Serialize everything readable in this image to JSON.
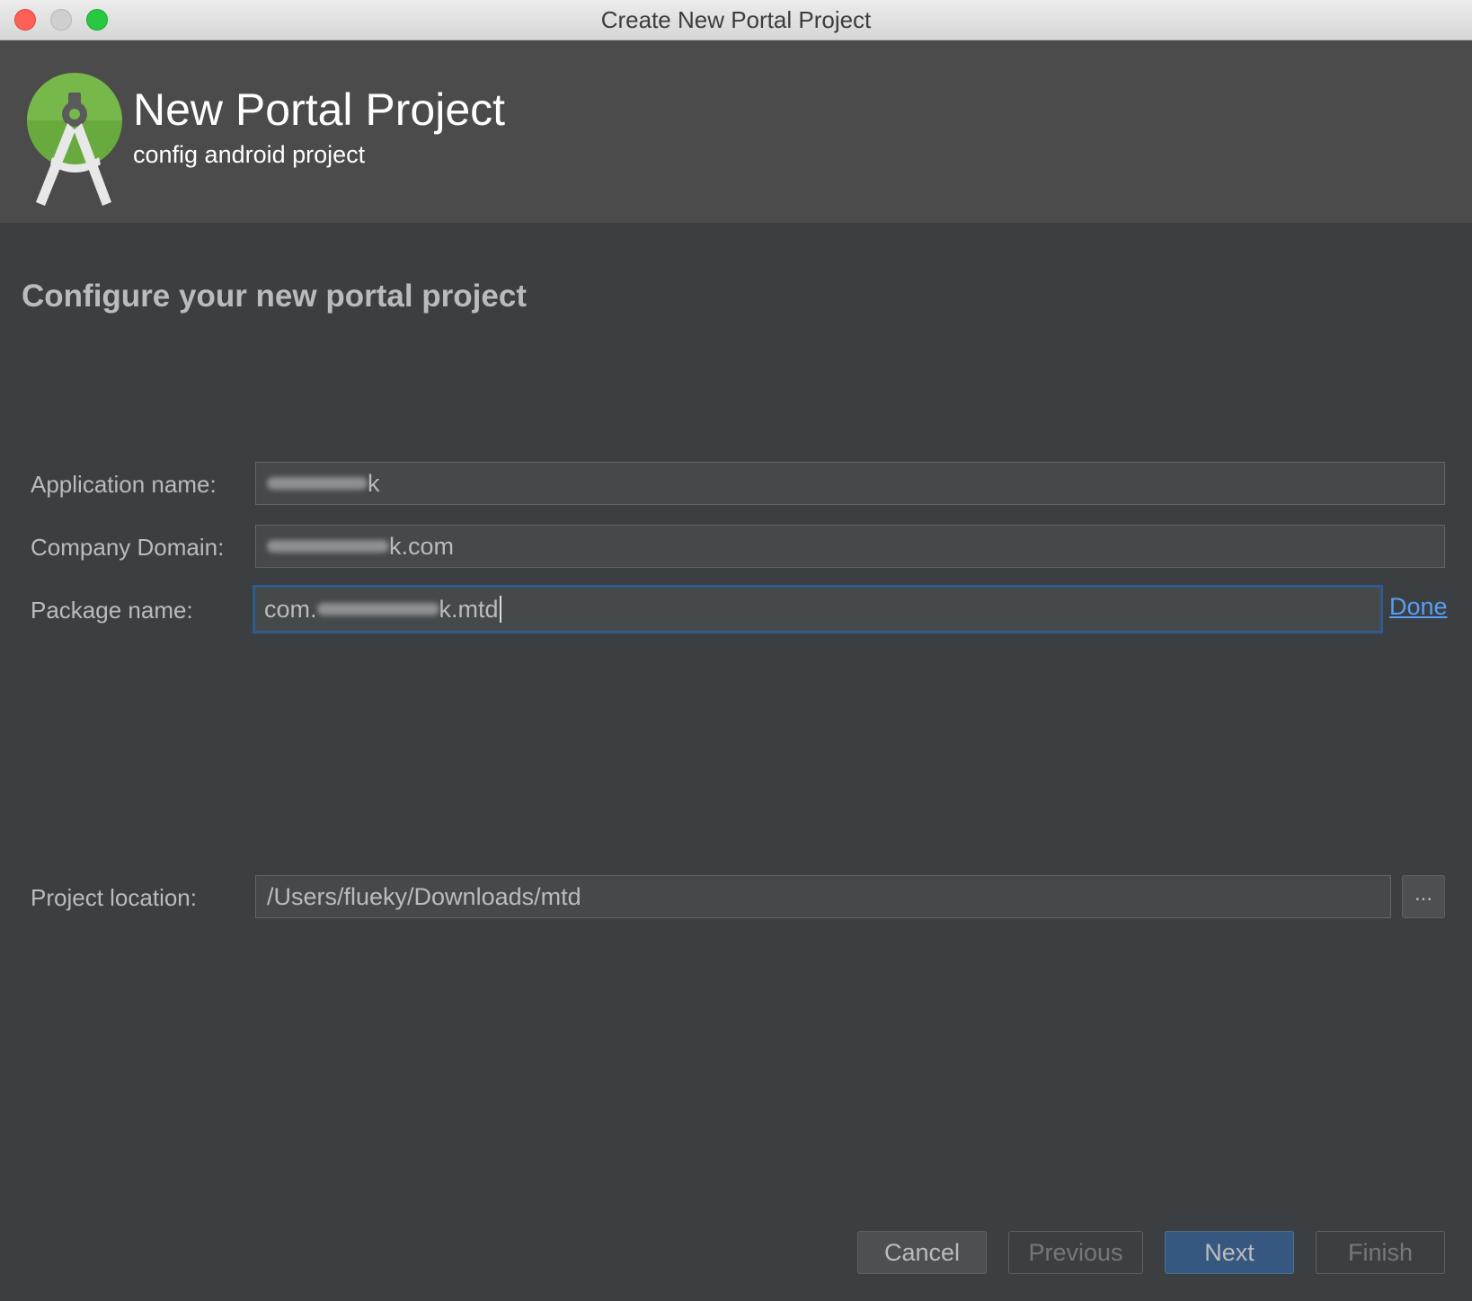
{
  "window": {
    "title": "Create New Portal Project"
  },
  "header": {
    "title": "New Portal Project",
    "subtitle": "config android project",
    "logo_icon": "android-studio-logo-icon"
  },
  "main": {
    "heading": "Configure your new portal project"
  },
  "form": {
    "application_name": {
      "label": "Application name:",
      "value_suffix": "k"
    },
    "company_domain": {
      "label": "Company Domain:",
      "value_suffix": "k.com"
    },
    "package_name": {
      "label": "Package name:",
      "value_prefix": "com.",
      "value_suffix": "k.mtd",
      "done_label": "Done"
    },
    "project_location": {
      "label": "Project location:",
      "value": "/Users/flueky/Downloads/mtd",
      "browse_label": "..."
    }
  },
  "footer": {
    "cancel_label": "Cancel",
    "previous_label": "Previous",
    "next_label": "Next",
    "finish_label": "Finish"
  },
  "colors": {
    "background": "#3c3f41",
    "header_background": "#4b4b4b",
    "field_background": "#45494a",
    "focus_border": "#2e5a8c",
    "link": "#589df6",
    "primary_button": "#365880",
    "logo_green": "#77b84a"
  }
}
